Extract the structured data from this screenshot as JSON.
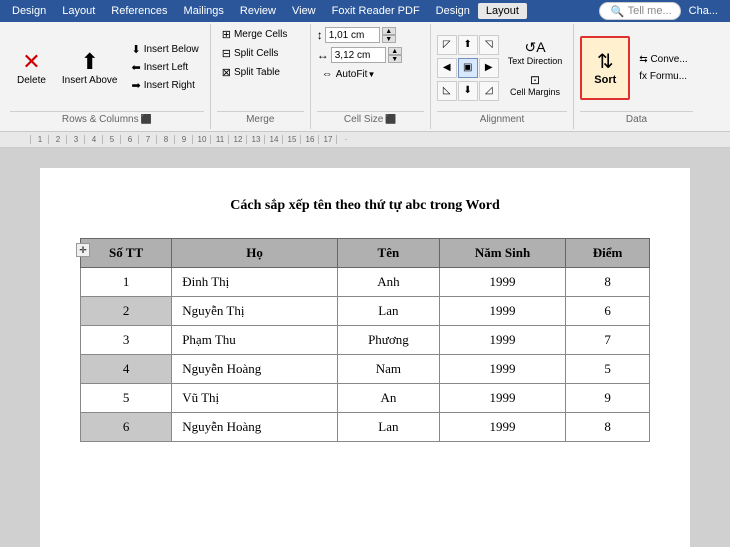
{
  "menubar": {
    "items": [
      "Design",
      "Layout",
      "References",
      "Mailings",
      "Review",
      "View",
      "Foxit Reader PDF",
      "Design",
      "Layout",
      "Tell me...",
      "Cha..."
    ]
  },
  "ribbon": {
    "active_tab": "Layout",
    "groups": {
      "rows_cols": {
        "label": "Rows & Columns",
        "delete_label": "Delete",
        "insert_above_label": "Insert\nAbove",
        "insert_below_label": "Insert Below",
        "insert_left_label": "Insert Left",
        "insert_right_label": "Insert Right"
      },
      "merge": {
        "label": "Merge",
        "merge_cells_label": "Merge Cells",
        "split_cells_label": "Split Cells",
        "split_table_label": "Split Table"
      },
      "cell_size": {
        "label": "Cell Size",
        "height_value": "1,01 cm",
        "width_value": "3,12 cm",
        "autofit_label": "AutoFit"
      },
      "alignment": {
        "label": "Alignment",
        "text_direction_label": "Text\nDirection",
        "cell_margins_label": "Cell\nMargins"
      },
      "data": {
        "label": "Data",
        "sort_label": "Sort",
        "convert_label": "Conve...",
        "formula_label": "fx Formu..."
      }
    }
  },
  "ruler": {
    "marks": [
      "1",
      "2",
      "3",
      "4",
      "5",
      "6",
      "7",
      "8",
      "9",
      "10",
      "11",
      "12",
      "13",
      "14",
      "15",
      "16",
      "17",
      "·"
    ]
  },
  "document": {
    "title": "Cách sắp xếp tên theo thứ tự abc trong Word",
    "table": {
      "headers": [
        "Số TT",
        "Họ",
        "Tên",
        "Năm Sinh",
        "Điểm"
      ],
      "rows": [
        [
          "1",
          "Đinh Thị",
          "Anh",
          "1999",
          "8"
        ],
        [
          "2",
          "Nguyễn Thị",
          "Lan",
          "1999",
          "6"
        ],
        [
          "3",
          "Phạm Thu",
          "Phương",
          "1999",
          "7"
        ],
        [
          "4",
          "Nguyễn Hoàng",
          "Nam",
          "1999",
          "5"
        ],
        [
          "5",
          "Vũ Thị",
          "An",
          "1999",
          "9"
        ],
        [
          "6",
          "Nguyễn Hoàng",
          "Lan",
          "1999",
          "8"
        ]
      ]
    }
  }
}
